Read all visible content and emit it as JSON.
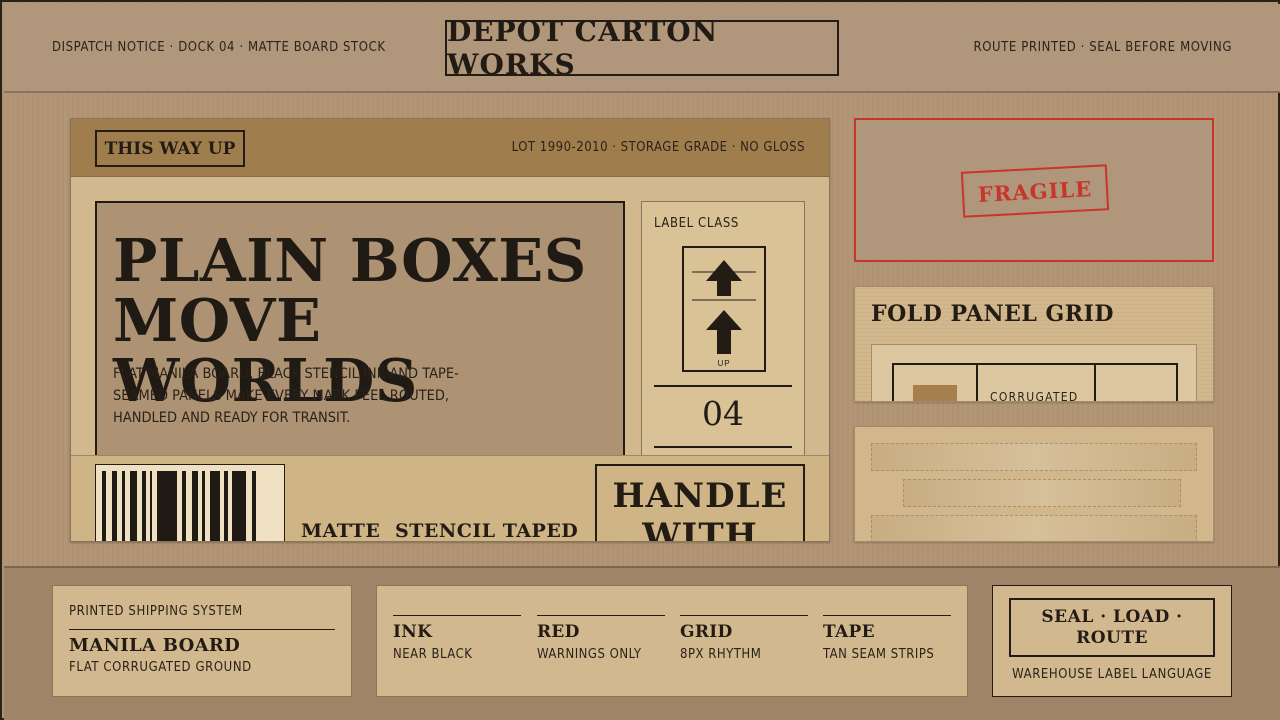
{
  "header": {
    "left_text": "DISPATCH NOTICE · DOCK 04 · MATTE BOARD STOCK",
    "brand": "DEPOT CARTON WORKS",
    "right_text": "ROUTE PRINTED · SEAL BEFORE MOVING"
  },
  "main_card": {
    "badge": "THIS WAY UP",
    "lot_text": "LOT 1990-2010 · STORAGE GRADE · NO GLOSS",
    "hero_title_line1": "PLAIN BOXES",
    "hero_title_line2": "MOVE WORLDS",
    "hero_body": "FLAT MANILA BOARD, BLACK STENCIL INK AND TAPE-SEAMED PANELS MAKE EVERY MARK FEEL ROUTED, HANDLED AND READY FOR TRANSIT.",
    "label_class": {
      "title": "LABEL CLASS",
      "up_text": "UP",
      "number": "04"
    },
    "footer": {
      "word1": "MATTE",
      "word2": "STENCIL TAPED",
      "handle_text": "HANDLE WITH"
    }
  },
  "side": {
    "fragile": "FRAGILE",
    "fold_title": "FOLD PANEL GRID",
    "fold_word": "CORRUGATED"
  },
  "bottom": {
    "system": {
      "eyebrow": "PRINTED SHIPPING SYSTEM",
      "title": "MANILA BOARD",
      "subtitle": "FLAT CORRUGATED GROUND"
    },
    "specs": [
      {
        "name": "INK",
        "desc": "NEAR BLACK"
      },
      {
        "name": "RED",
        "desc": "WARNINGS ONLY"
      },
      {
        "name": "GRID",
        "desc": "8PX RHYTHM"
      },
      {
        "name": "TAPE",
        "desc": "TAN SEAM STRIPS"
      }
    ],
    "seal": {
      "title": "SEAL · LOAD · ROUTE",
      "subtitle": "WAREHOUSE LABEL LANGUAGE"
    }
  },
  "colors": {
    "ink": "#231c15",
    "warning_red": "#c7362b",
    "board": "#d2b88e",
    "background": "#b29676"
  }
}
